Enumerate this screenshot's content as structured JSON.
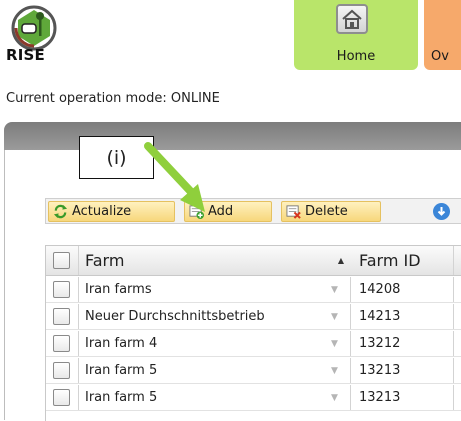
{
  "header": {
    "logo_text": "RISE",
    "nav": [
      {
        "label": "Home",
        "color": "#b9e56a",
        "icon": "home-icon"
      },
      {
        "label": "Ov",
        "color": "#f6a96b"
      }
    ],
    "operation_mode": "Current operation mode: ONLINE"
  },
  "annotation": {
    "label": "(i)",
    "arrow_color": "#8fcf3c"
  },
  "toolbar": {
    "buttons": [
      {
        "label": "Actualize",
        "icon": "refresh-icon"
      },
      {
        "label": "Add",
        "icon": "add-icon"
      },
      {
        "label": "Delete",
        "icon": "delete-icon"
      }
    ],
    "extra_icon": "download-icon"
  },
  "table": {
    "columns": [
      "Farm",
      "Farm ID"
    ],
    "rows": [
      {
        "farm": "Iran farms",
        "id": "14208"
      },
      {
        "farm": "Neuer Durchschnittsbetrieb",
        "id": "14213"
      },
      {
        "farm": "Iran farm 4",
        "id": "13212"
      },
      {
        "farm": "Iran farm 5",
        "id": "13213"
      },
      {
        "farm": "Iran farm 5",
        "id": "13213"
      }
    ]
  }
}
